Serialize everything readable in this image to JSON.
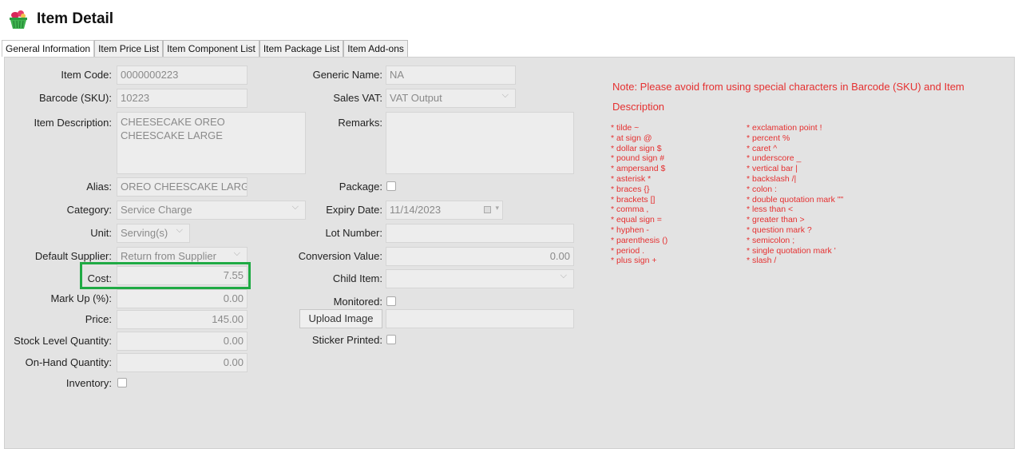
{
  "header": {
    "title": "Item Detail",
    "icon": "basket-icon"
  },
  "tabs": [
    {
      "label": "General Information",
      "active": true
    },
    {
      "label": "Item Price List",
      "active": false
    },
    {
      "label": "Item Component List",
      "active": false
    },
    {
      "label": "Item Package List",
      "active": false
    },
    {
      "label": "Item Add-ons",
      "active": false
    }
  ],
  "left": {
    "item_code": {
      "label": "Item Code:",
      "value": "0000000223"
    },
    "barcode": {
      "label": "Barcode (SKU):",
      "value": "10223"
    },
    "description": {
      "label": "Item Description:",
      "value": "CHEESECAKE  OREO CHEESCAKE LARGE"
    },
    "alias": {
      "label": "Alias:",
      "value": "OREO CHEESCAKE LARGE"
    },
    "category": {
      "label": "Category:",
      "value": "Service Charge"
    },
    "unit": {
      "label": "Unit:",
      "value": "Serving(s)"
    },
    "supplier": {
      "label": "Default Supplier:",
      "value": "Return from Supplier"
    },
    "cost": {
      "label": "Cost:",
      "value": "7.55"
    },
    "markup": {
      "label": "Mark Up (%):",
      "value": "0.00"
    },
    "price": {
      "label": "Price:",
      "value": "145.00"
    },
    "stock_level": {
      "label": "Stock Level Quantity:",
      "value": "0.00"
    },
    "on_hand": {
      "label": "On-Hand Quantity:",
      "value": "0.00"
    },
    "inventory": {
      "label": "Inventory:",
      "checked": false
    }
  },
  "middle": {
    "generic_name": {
      "label": "Generic Name:",
      "value": "NA"
    },
    "sales_vat": {
      "label": "Sales VAT:",
      "value": "VAT Output"
    },
    "remarks": {
      "label": "Remarks:",
      "value": ""
    },
    "package": {
      "label": "Package:",
      "checked": false
    },
    "expiry": {
      "label": "Expiry Date:",
      "value": "11/14/2023"
    },
    "lot_number": {
      "label": "Lot Number:",
      "value": ""
    },
    "conversion": {
      "label": "Conversion Value:",
      "value": "0.00"
    },
    "child_item": {
      "label": "Child Item:",
      "value": ""
    },
    "monitored": {
      "label": "Monitored:",
      "checked": false
    },
    "upload_label": "Upload Image",
    "sticker": {
      "label": "Sticker Printed:",
      "checked": false
    }
  },
  "note": {
    "text": "Note: Please avoid from using special characters in Barcode (SKU) and Item Description",
    "col1": [
      "* tilde ~",
      "* at sign @",
      "* dollar sign $",
      "* pound sign #",
      "* ampersand $",
      "* asterisk *",
      "* braces {}",
      "* brackets []",
      "* comma ,",
      "* equal sign =",
      "* hyphen -",
      "* parenthesis ()",
      "* period .",
      "* plus sign +"
    ],
    "col2": [
      "* exclamation point !",
      "* percent %",
      "* caret  ^",
      "* underscore  _",
      "* vertical bar  |",
      "* backslash  /|",
      "* colon  :",
      "* double quotation mark  \"\"",
      "* less than  <",
      "* greater than  >",
      "* question mark  ?",
      "* semicolon ;",
      "* single quotation mark '",
      "* slash /"
    ]
  },
  "colors": {
    "note": "#e53030",
    "highlight": "#1faa44",
    "panel": "#e3e3e3"
  }
}
